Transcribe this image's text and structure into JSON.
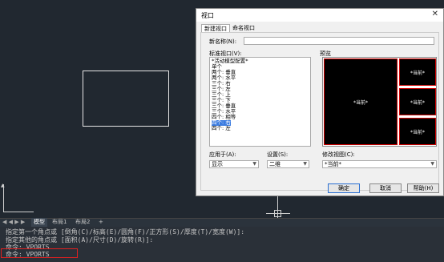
{
  "layout_tabs": {
    "nav_arrows": "◀ ◀ ▶ ▶",
    "items": [
      "模型",
      "布局1",
      "布局2",
      "+"
    ]
  },
  "command_lines": [
    "指定第一个角点或 [倒角(C)/标高(E)/圆角(F)/正方形(S)/厚度(T)/宽度(W)]:",
    "指定其他的角点或 [面积(A)/尺寸(D)/旋转(R)]:",
    "命令: VPORTS",
    "命令: VPORTS"
  ],
  "dialog": {
    "title": "视口",
    "close": "✕",
    "tabs": [
      "新建视口",
      "命名视口"
    ],
    "new_name_label": "新名称(N):",
    "new_name_value": "",
    "standard_label": "标准视口(V):",
    "standard_list": [
      "*活动模型配置*",
      "单个",
      "两个: 垂直",
      "两个: 水平",
      "三个: 右",
      "三个: 左",
      "三个: 上",
      "三个: 下",
      "三个: 垂直",
      "三个: 水平",
      "四个: 相等",
      "四个: 右",
      "四个: 左"
    ],
    "selected_index": 11,
    "preview_label": "预览",
    "preview_cell_text": "*当前*",
    "apply_label": "应用于(A):",
    "apply_value": "显示",
    "setup_label": "设置(S):",
    "setup_value": "二维",
    "change_view_label": "修改视图(C):",
    "change_view_value": "*当前*",
    "buttons": {
      "ok": "确定",
      "cancel": "取消",
      "help": "帮助(H)"
    }
  }
}
